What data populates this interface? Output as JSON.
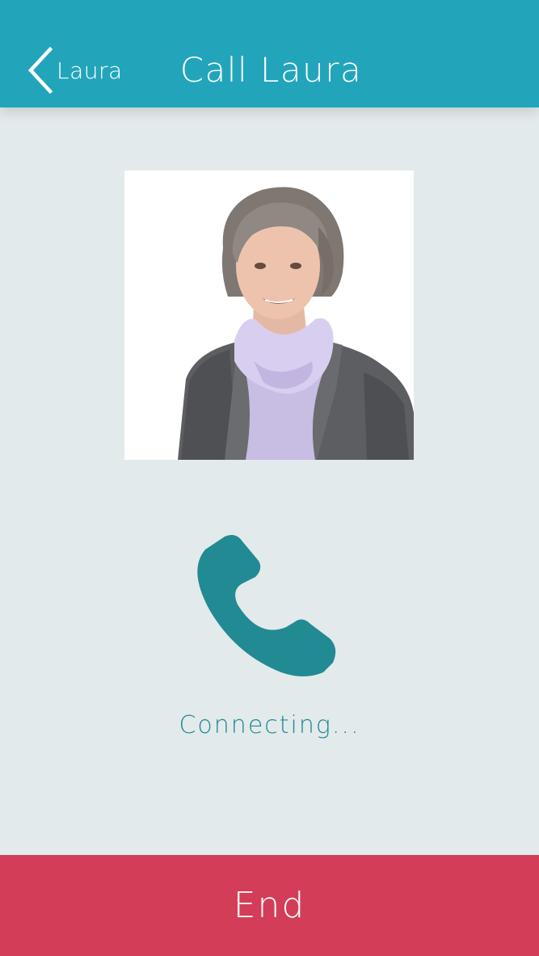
{
  "header": {
    "back_label": "Laura",
    "title": "Call Laura",
    "background_color": "#22a5bb"
  },
  "contact": {
    "photo_alt": "Laura"
  },
  "call": {
    "icon": "phone-icon",
    "status": "Connecting...",
    "accent_color": "#228a92"
  },
  "footer": {
    "end_label": "End",
    "end_color": "#d43d57"
  }
}
